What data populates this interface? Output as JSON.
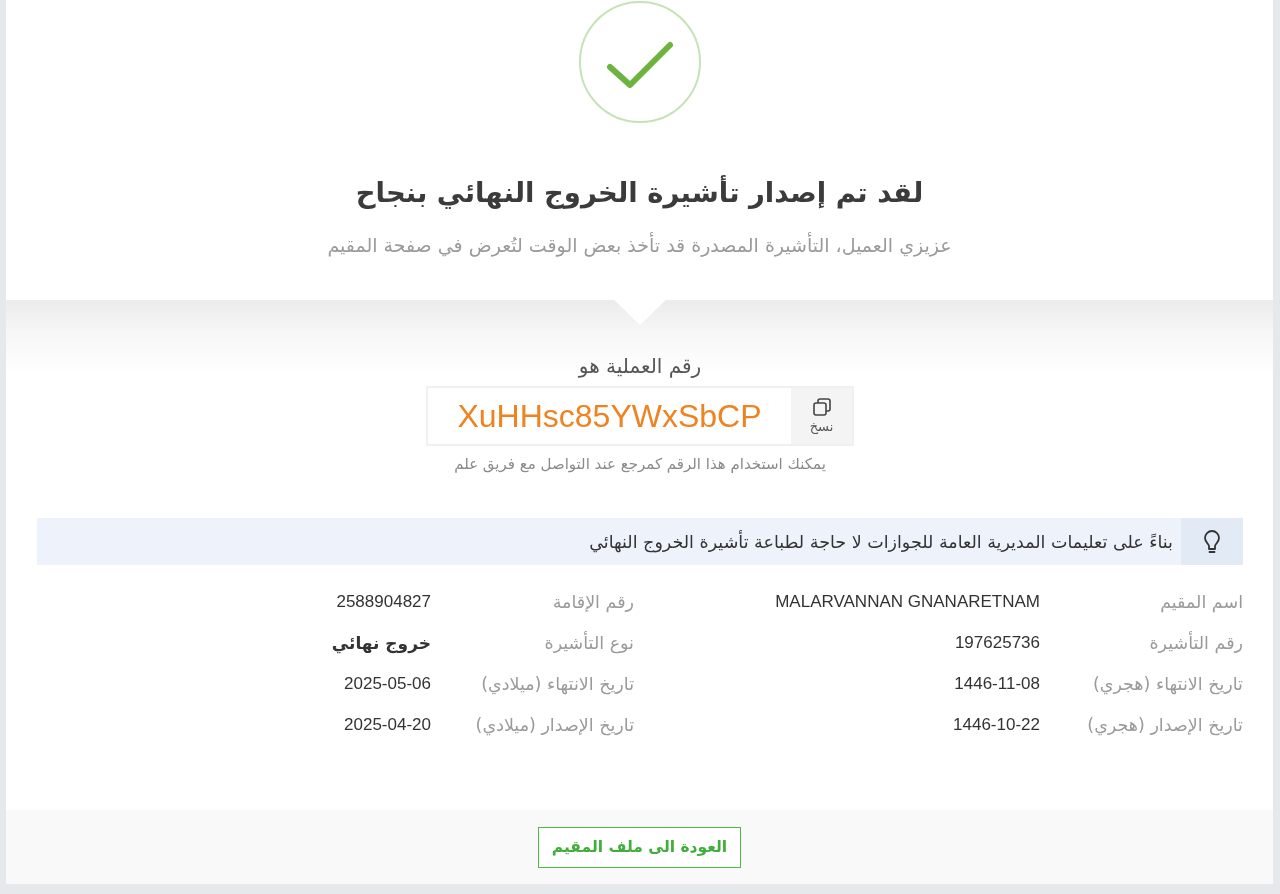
{
  "title": "لقد تم إصدار تأشيرة الخروج النهائي بنجاح",
  "subtitle": "عزيزي العميل، التأشيرة المصدرة قد تأخذ بعض الوقت لتُعرض في صفحة المقيم",
  "transaction": {
    "label": "رقم العملية هو",
    "number": "XuHHsc85YWxSbCP",
    "copy_label": "نسخ",
    "hint": "يمكنك استخدام هذا الرقم كمرجع عند التواصل مع فريق علم"
  },
  "notice": {
    "text": "بناءً على تعليمات المديرية العامة للجوازات لا حاجة لطباعة تأشيرة الخروج النهائي"
  },
  "details": [
    {
      "label": "اسم المقيم",
      "value": "MALARVANNAN GNANARETNAM",
      "emphasized": false
    },
    {
      "label": "رقم الإقامة",
      "value": "2588904827",
      "emphasized": false
    },
    {
      "label": "رقم التأشيرة",
      "value": "197625736",
      "emphasized": false
    },
    {
      "label": "نوع التأشيرة",
      "value": "خروج نهائي",
      "emphasized": true
    },
    {
      "label": "تاريخ الانتهاء (هجري)",
      "value": "1446-11-08",
      "emphasized": false
    },
    {
      "label": "تاريخ الانتهاء (ميلادي)",
      "value": "2025-05-06",
      "emphasized": false
    },
    {
      "label": "تاريخ الإصدار (هجري)",
      "value": "1446-10-22",
      "emphasized": false
    },
    {
      "label": "تاريخ الإصدار (ميلادي)",
      "value": "2025-04-20",
      "emphasized": false
    }
  ],
  "back_button": {
    "label": "العودة الى ملف المقيم"
  }
}
